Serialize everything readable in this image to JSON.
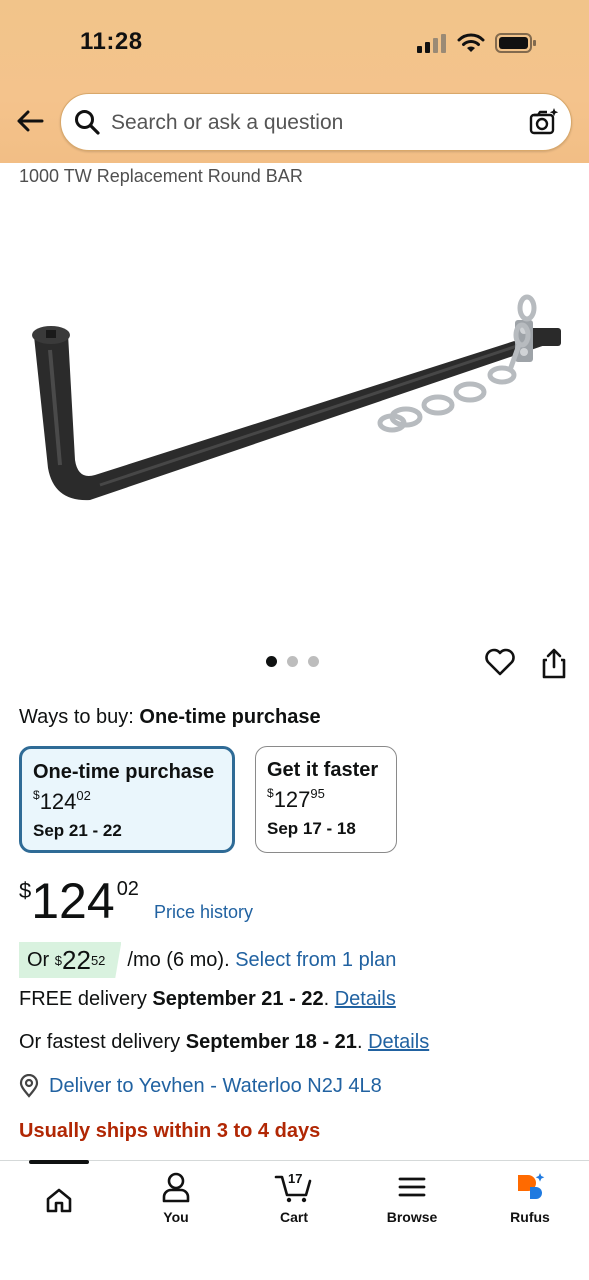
{
  "status_bar": {
    "time": "11:28"
  },
  "search": {
    "placeholder": "Search or ask a question"
  },
  "product": {
    "title": "1000 TW Replacement Round BAR",
    "image_alt": "Black weight distribution spring bar with chain",
    "image_count": 3,
    "active_image": 1
  },
  "ways_to_buy": {
    "label": "Ways to buy:",
    "selected": "One-time purchase",
    "options": [
      {
        "title": "One-time purchase",
        "currency": "$",
        "whole": "124",
        "cents": "02",
        "dates": "Sep 21 - 22"
      },
      {
        "title": "Get it faster",
        "currency": "$",
        "whole": "127",
        "cents": "95",
        "dates": "Sep 17 - 18"
      }
    ]
  },
  "price": {
    "currency": "$",
    "whole": "124",
    "cents": "02",
    "history_link": "Price history"
  },
  "monthly": {
    "prefix": "Or",
    "currency": "$",
    "whole": "22",
    "cents": "52",
    "suffix": "/mo (6 mo).",
    "plan_link": "Select from 1 plan"
  },
  "delivery": {
    "free_prefix": "FREE delivery",
    "free_dates": "September 21 - 22",
    "free_link": "Details",
    "fast_prefix": "Or fastest delivery",
    "fast_dates": "September 18 - 21",
    "fast_link": "Details",
    "deliver_to": "Deliver to Yevhen - Waterloo N2J 4L8",
    "ships": "Usually ships within 3 to 4 days"
  },
  "tabbar": {
    "items": [
      {
        "label": "",
        "icon": "home-icon"
      },
      {
        "label": "You",
        "icon": "person-icon"
      },
      {
        "label": "Cart",
        "icon": "cart-icon",
        "count": "17"
      },
      {
        "label": "Browse",
        "icon": "menu-icon"
      },
      {
        "label": "Rufus",
        "icon": "rufus-icon"
      }
    ]
  },
  "colors": {
    "header": "#f3c48a",
    "link": "#2162a1",
    "alert": "#b12704",
    "selected_border": "#2f6b96",
    "selected_bg": "#eaf6fc"
  }
}
